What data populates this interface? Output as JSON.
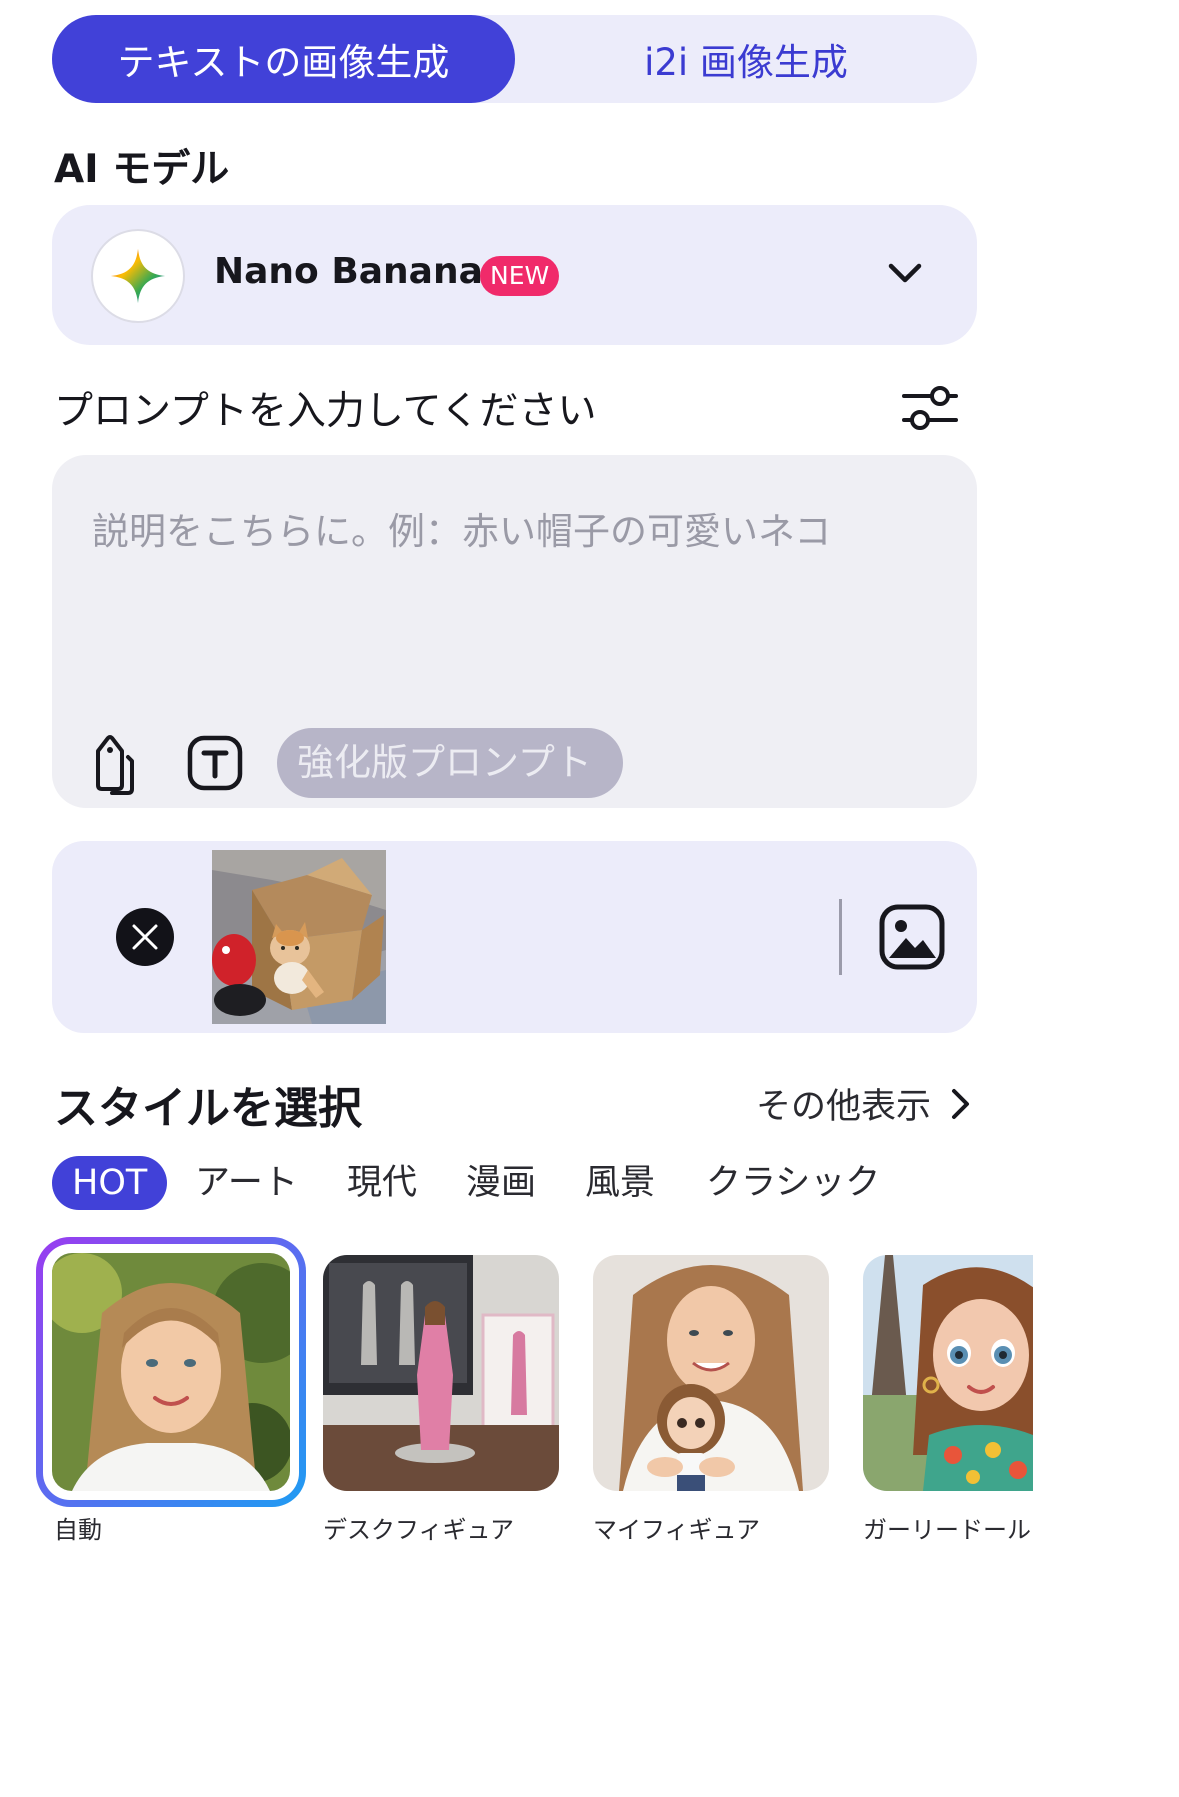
{
  "mode_tabs": {
    "text_to_image": "テキストの画像生成",
    "image_to_image": "i2i 画像生成"
  },
  "ai_model": {
    "title": "AI モデル",
    "selected_model": "Nano Banana",
    "badge": "NEW",
    "logo_icon": "sparkle-star-icon"
  },
  "prompt": {
    "title": "プロンプトを入力してください",
    "placeholder": "説明をこちらに。例：赤い帽子の可愛いネコ",
    "enhance_label": "強化版プロンプト"
  },
  "upload": {
    "thumbnail_alt": "cat in cardboard box"
  },
  "styles": {
    "title": "スタイルを選択",
    "more_label": "その他表示",
    "categories": [
      "HOT",
      "アート",
      "現代",
      "漫画",
      "風景",
      "クラシック"
    ],
    "items": [
      {
        "label": "自動",
        "selected": true
      },
      {
        "label": "デスクフィギュア",
        "selected": false
      },
      {
        "label": "マイフィギュア",
        "selected": false
      },
      {
        "label": "ガーリードール",
        "selected": false
      }
    ]
  },
  "colors": {
    "accent": "#4141d8",
    "badge": "#f02a6a",
    "panel": "#ececfa",
    "prompt_bg": "#efeff4",
    "selected_gradient": [
      "#9a3cf0",
      "#1f9cf2"
    ]
  }
}
